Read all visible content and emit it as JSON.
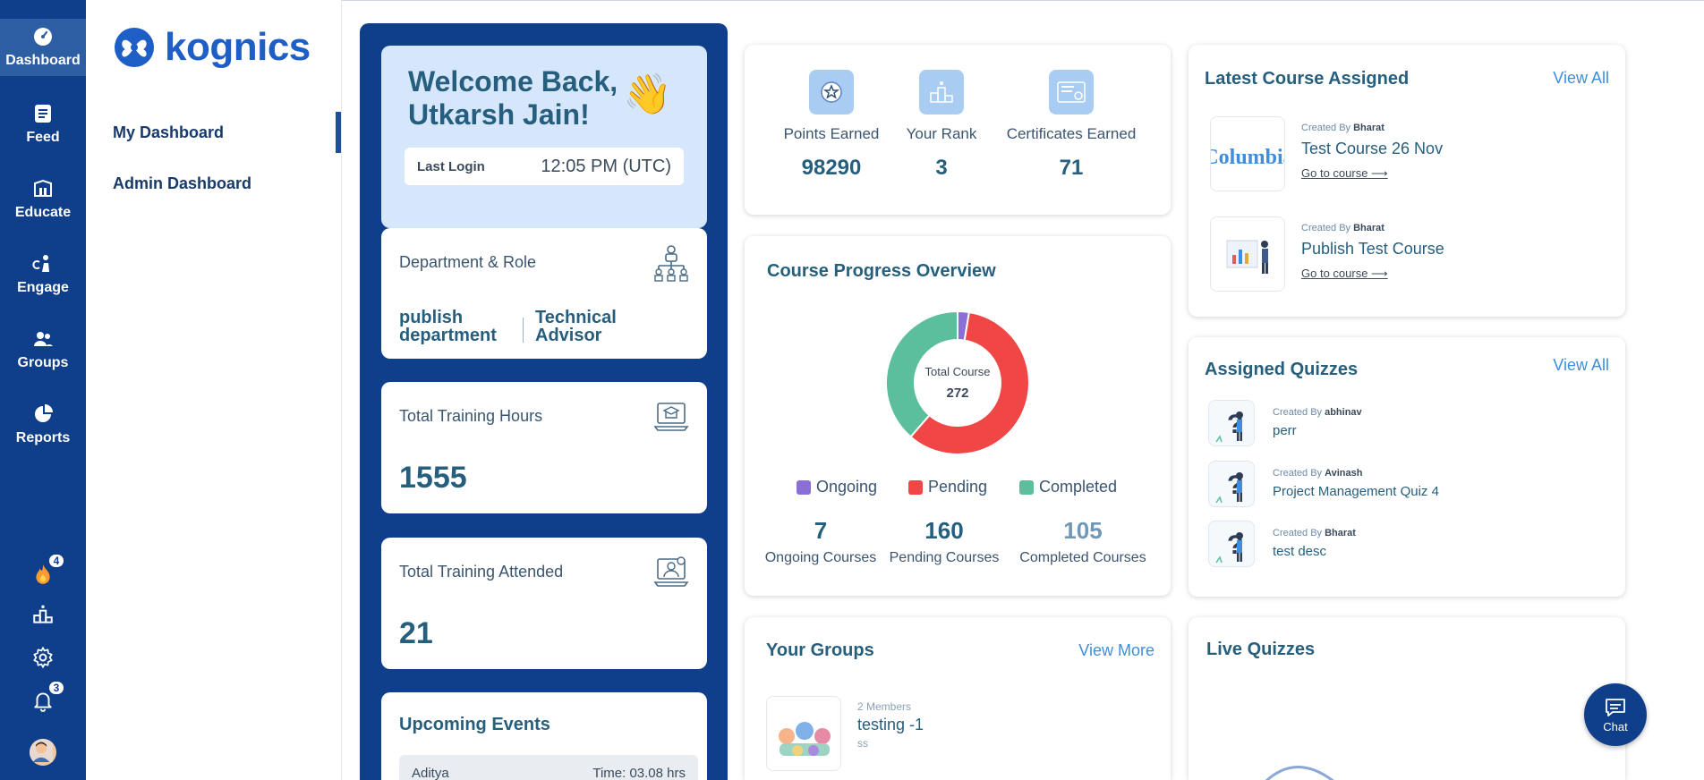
{
  "rail": {
    "items": [
      {
        "label": "Dashboard",
        "icon": "dashboard-icon"
      },
      {
        "label": "Feed",
        "icon": "feed-icon"
      },
      {
        "label": "Educate",
        "icon": "educate-icon"
      },
      {
        "label": "Engage",
        "icon": "engage-icon"
      },
      {
        "label": "Groups",
        "icon": "groups-icon"
      },
      {
        "label": "Reports",
        "icon": "reports-icon"
      }
    ],
    "streak_count": "4",
    "notification_count": "3"
  },
  "subnav": {
    "logo": "kognics",
    "items": [
      "My Dashboard",
      "Admin Dashboard"
    ]
  },
  "profile": {
    "welcome_line1": "Welcome Back,",
    "welcome_line2": "Utkarsh Jain!",
    "wave_emoji": "👋",
    "last_login_label": "Last Login",
    "last_login_value": "12:05 PM (UTC)",
    "dept_title": "Department & Role",
    "dept_value_line1": "publish",
    "dept_value_line2": "department",
    "role_line1": "Technical",
    "role_line2": "Advisor",
    "hours_title": "Total Training Hours",
    "hours_value": "1555",
    "attended_title": "Total Training Attended",
    "attended_value": "21",
    "events_title": "Upcoming Events",
    "event_name": "Aditya",
    "event_time": "Time: 03.08 hrs"
  },
  "stats": [
    {
      "label": "Points Earned",
      "value": "98290",
      "icon": "star-badge-icon"
    },
    {
      "label": "Your Rank",
      "value": "3",
      "icon": "podium-icon"
    },
    {
      "label": "Certificates Earned",
      "value": "71",
      "icon": "certificate-icon"
    }
  ],
  "progress": {
    "title": "Course Progress Overview",
    "center_label": "Total Course",
    "center_value": "272",
    "legend": [
      "Ongoing",
      "Pending",
      "Completed"
    ],
    "numbers": [
      {
        "value": "7",
        "label": "Ongoing Courses"
      },
      {
        "value": "160",
        "label": "Pending Courses"
      },
      {
        "value": "105",
        "label": "Completed Courses"
      }
    ]
  },
  "chart_data": {
    "type": "pie",
    "categories": [
      "Ongoing",
      "Pending",
      "Completed"
    ],
    "values": [
      7,
      160,
      105
    ],
    "colors": [
      "#8a6fd6",
      "#f04646",
      "#5bbf9e"
    ],
    "donut": true
  },
  "latest_courses": {
    "title": "Latest Course Assigned",
    "view_all": "View All",
    "created_by_label": "Created By",
    "go_to_label": "Go to course ⟶",
    "items": [
      {
        "creator": "Bharat",
        "name": "Test Course 26 Nov",
        "thumb_text": "Columbia"
      },
      {
        "creator": "Bharat",
        "name": "Publish Test Course"
      }
    ]
  },
  "quizzes": {
    "title": "Assigned Quizzes",
    "view_all": "View All",
    "created_by_label": "Created By",
    "items": [
      {
        "creator": "abhinav",
        "name": "perr"
      },
      {
        "creator": "Avinash",
        "name": "Project Management Quiz 4"
      },
      {
        "creator": "Bharat",
        "name": "test desc"
      }
    ]
  },
  "groups": {
    "title": "Your Groups",
    "view_more": "View More",
    "members": "2 Members",
    "name": "testing -1",
    "desc": "ss"
  },
  "live_quizzes": {
    "title": "Live Quizzes"
  },
  "chat": {
    "label": "Chat"
  }
}
